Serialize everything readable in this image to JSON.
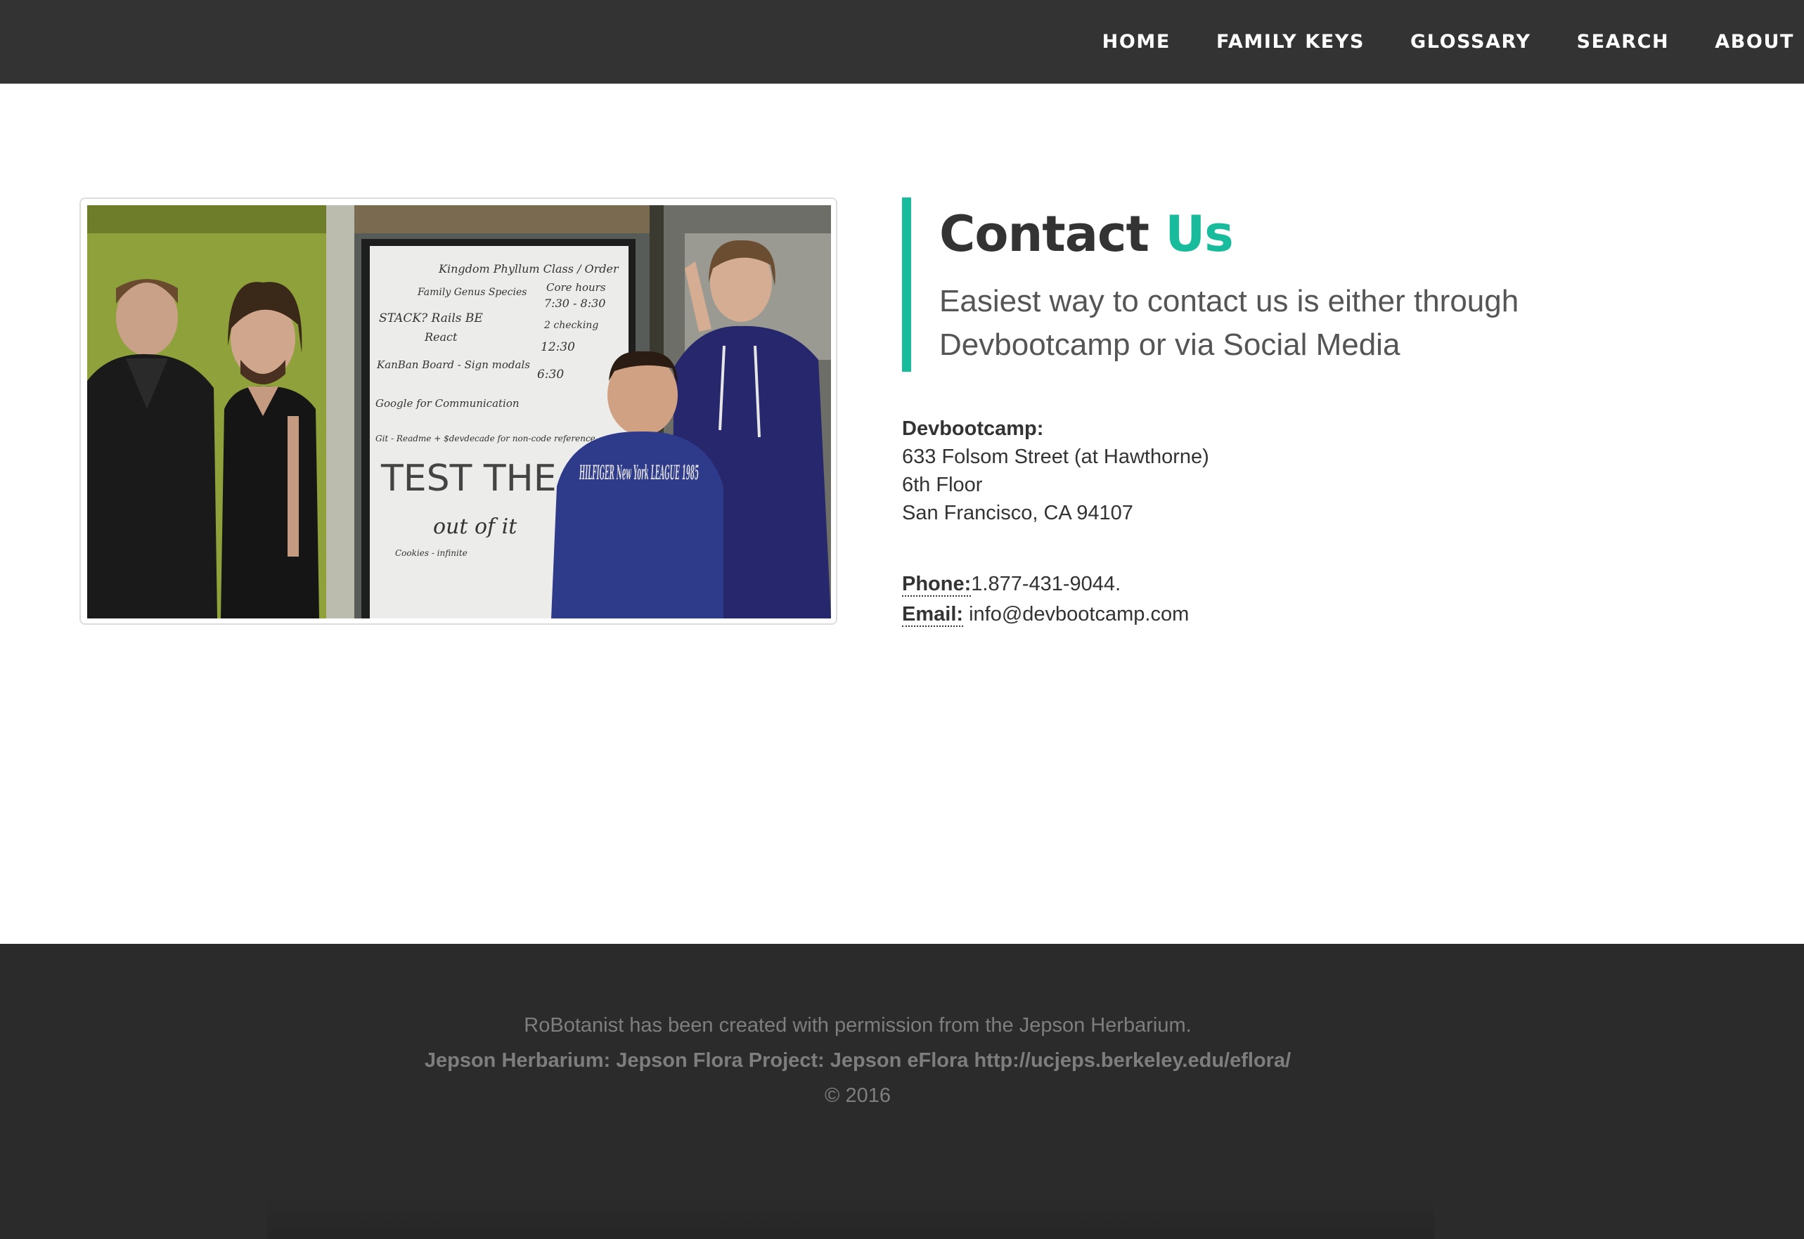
{
  "nav": {
    "items": [
      {
        "label": "HOME"
      },
      {
        "label": "FAMILY KEYS"
      },
      {
        "label": "GLOSSARY"
      },
      {
        "label": "SEARCH"
      },
      {
        "label": "ABOUT"
      }
    ]
  },
  "photo": {
    "whiteboard": {
      "header": "Kingdom Phyllum Class / Order",
      "line1": "Family Genus Species",
      "line2": "Core hours",
      "line3": "7:30 - 8:30",
      "line4": "STACK? Rails BE",
      "line5": "React",
      "line6": "2 checking",
      "line7": "12:30",
      "line8": "KanBan Board - Sign modals",
      "line9": "6:30",
      "line10": "Google for Communication",
      "line11": "Git - Readme + $devdecade for non-code reference",
      "line12": "TEST THE",
      "line13": "out of it",
      "line14": "Cookies - infinite"
    },
    "hoodie_text": "HILFIGER New York LEAGUE 1985"
  },
  "contact": {
    "title_main": "Contact",
    "title_accent": "Us",
    "subtitle_line1": "Easiest way to contact us is either through",
    "subtitle_line2": "Devbootcamp or via Social Media",
    "address": {
      "name": "Devbootcamp:",
      "street": "633 Folsom Street (at Hawthorne)",
      "floor": "6th Floor",
      "city": "San Francisco, CA 94107"
    },
    "phone_label": "Phone:",
    "phone_value": "1.877-431-9044.",
    "email_label": "Email:",
    "email_value": "info@devbootcamp.com"
  },
  "footer": {
    "line1": "RoBotanist has been created with permission from the Jepson Herbarium.",
    "line2": "Jepson Herbarium: Jepson Flora Project: Jepson eFlora http://ucjeps.berkeley.edu/eflora/",
    "line3": "© 2016"
  },
  "colors": {
    "accent": "#18bc9c",
    "navbar": "#333333",
    "footer": "#2b2b2b"
  }
}
